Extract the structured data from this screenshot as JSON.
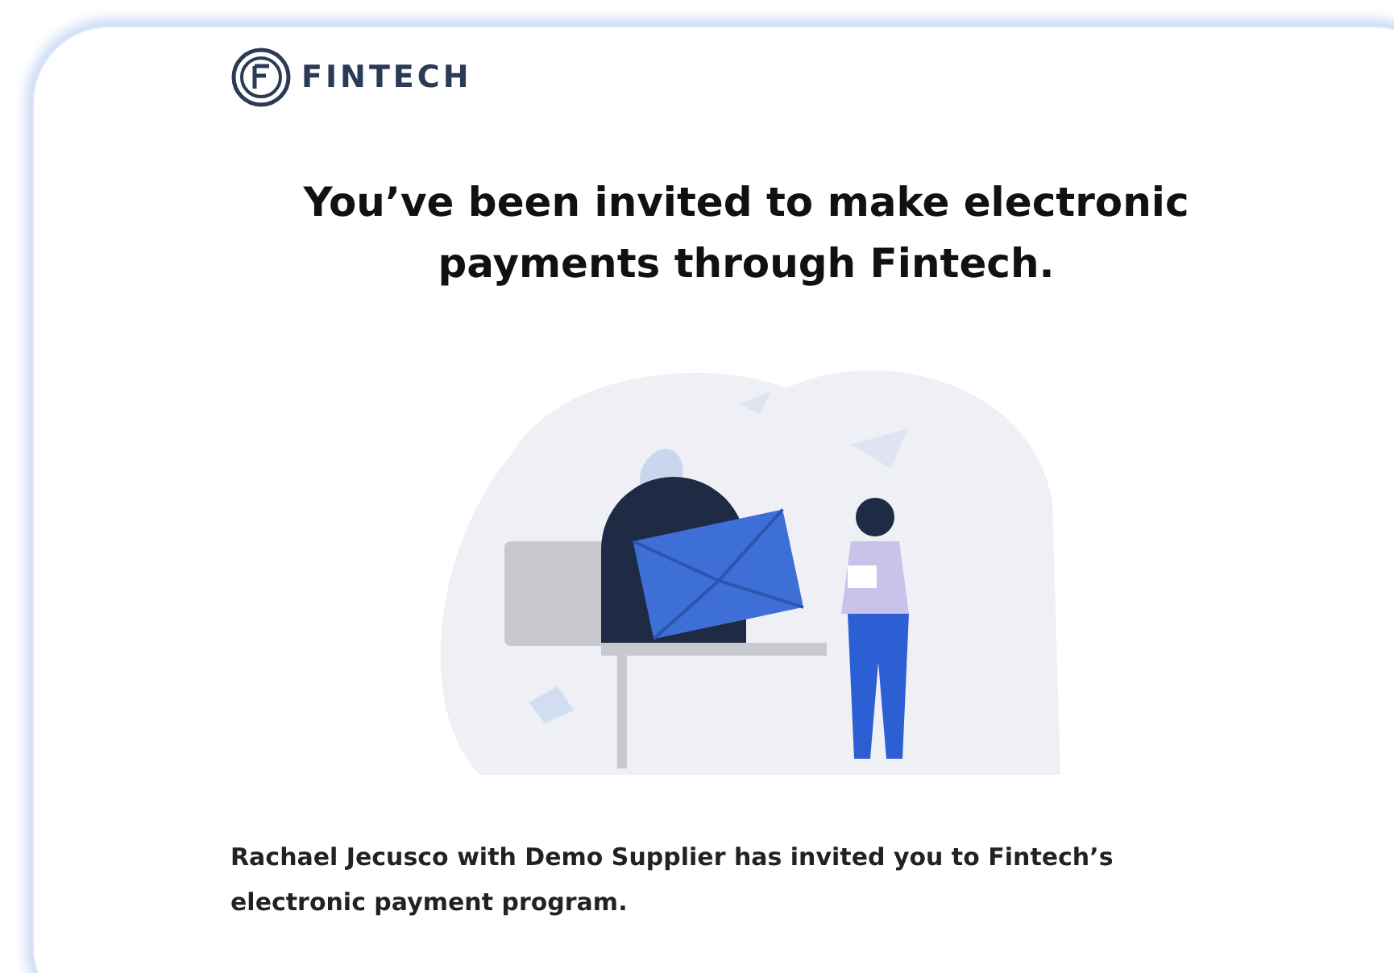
{
  "logo": {
    "text": "FINTECH"
  },
  "heading": "You’ve been invited to make electronic payments through Fintech.",
  "message": "Rachael Jecusco with Demo Supplier has invited you to Fintech’s electronic payment program."
}
